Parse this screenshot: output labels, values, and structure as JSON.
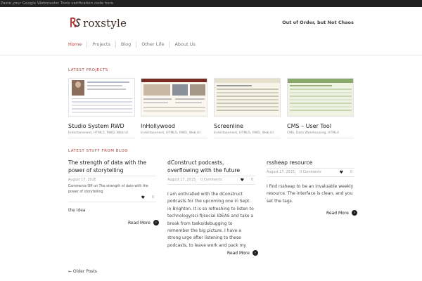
{
  "topbar": {
    "text": "Paste your Google Webmaster Tools verification code here"
  },
  "header": {
    "logo_text": "roxstyle",
    "tagline": "Out of Order, but Not Chaos"
  },
  "nav": {
    "items": [
      {
        "label": "Home",
        "active": true
      },
      {
        "label": "Projects",
        "active": false
      },
      {
        "label": "Blog",
        "active": false
      },
      {
        "label": "Other Life",
        "active": false
      },
      {
        "label": "About Us",
        "active": false
      }
    ]
  },
  "projects": {
    "heading": "LATEST PROJECTS",
    "items": [
      {
        "title": "Studio System RWD",
        "cats": "Entertainment, HTML5, RWD, Web UI"
      },
      {
        "title": "InHollywood",
        "cats": "Entertainment, HTML5, RWD, Web UI"
      },
      {
        "title": "Screenline",
        "cats": "Entertainment, HTML5, RWD, Web UI"
      },
      {
        "title": "CMS – User Tool",
        "cats": "CMS, Data Warehousing, HTML4"
      }
    ]
  },
  "blog": {
    "heading": "LATEST STUFF FROM BLOG",
    "posts": [
      {
        "title": "The strength of data with the power of storytelling",
        "date": "August 17, 2015",
        "comments": "Comments Off on The strength of data with the power of storytelling",
        "count": "0",
        "excerpt": "the idea",
        "readmore": "Read More"
      },
      {
        "title": "dConstruct podcasts, overflowing with the future",
        "date": "August 17, 2015",
        "comments": "0 Comments",
        "count": "0",
        "excerpt": "I am enthralled with the dConstruct podcasts for the upcoming one in Sept. in Brighton. It is so refreshing to listen to technology/sci-fi/social IDEAS and take a break from tasks/debugging to remember the big picture. I have a strong urge after listening to these podcasts, to leave work and pack my",
        "readmore": "Read More"
      },
      {
        "title": "rssheap resource",
        "date": "August 17, 2015",
        "comments": "0 Comments",
        "count": "0",
        "excerpt": "I find rssheap to be an invaluable weekly resource. The interface is clean, and you set the tags.",
        "readmore": "Read More"
      }
    ]
  },
  "pagination": {
    "older": "← Older Posts"
  },
  "colors": {
    "accent": "#b2403a",
    "topbar": "#222222",
    "text": "#333333"
  },
  "icons": {
    "heart": "heart-icon",
    "arrow": "arrow-right-icon"
  }
}
